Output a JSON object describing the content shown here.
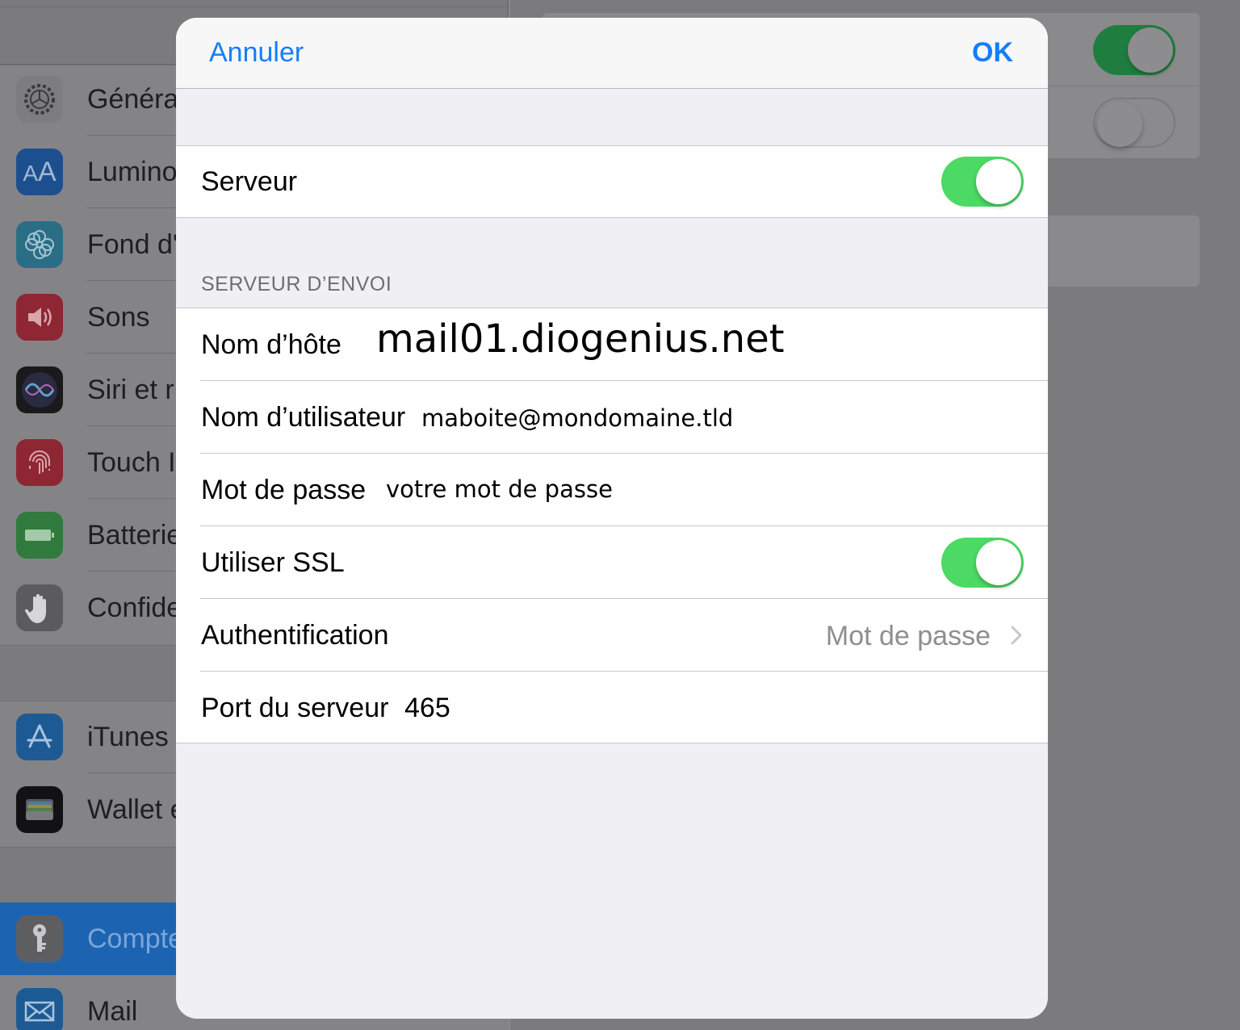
{
  "background": {
    "sidebar_items": [
      {
        "label": "Généra",
        "icon": "gear-icon",
        "color": "#8e8e93"
      },
      {
        "label": "Lumino",
        "icon": "text-size-icon",
        "color": "#1f6fd9"
      },
      {
        "label": "Fond d'",
        "icon": "wallpaper-flower-icon",
        "color": "#35a3cf"
      },
      {
        "label": "Sons",
        "icon": "speaker-icon",
        "color": "#e0394c"
      },
      {
        "label": "Siri et r",
        "icon": "siri-icon",
        "color": "#222222"
      },
      {
        "label": "Touch I",
        "icon": "fingerprint-icon",
        "color": "#e0394c"
      },
      {
        "label": "Batterie",
        "icon": "battery-icon",
        "color": "#4cd964"
      },
      {
        "label": "Confide",
        "icon": "hand-icon",
        "color": "#8e8e93"
      },
      {
        "label": "iTunes",
        "icon": "app-store-icon",
        "color": "#1f8cf0"
      },
      {
        "label": "Wallet e",
        "icon": "wallet-icon",
        "color": "#111111"
      },
      {
        "label": "Compte",
        "icon": "key-icon",
        "color": "#8e8e93"
      },
      {
        "label": "Mail",
        "icon": "mail-envelope-icon",
        "color": "#1f8cf0"
      }
    ]
  },
  "sheet": {
    "nav": {
      "cancel_label": "Annuler",
      "ok_label": "OK"
    },
    "server_row": {
      "label": "Serveur",
      "toggle_on": true
    },
    "section_header": "SERVEUR D’ENVOI",
    "rows": {
      "hostname": {
        "label": "Nom d’hôte",
        "value": "mail01.diogenius.net"
      },
      "username": {
        "label": "Nom d’utilisateur",
        "value": "maboite@mondomaine.tld"
      },
      "password": {
        "label": "Mot de passe",
        "value": "votre mot de passe"
      },
      "ssl": {
        "label": "Utiliser SSL",
        "toggle_on": true
      },
      "auth": {
        "label": "Authentification",
        "value": "Mot de passe"
      },
      "port": {
        "label": "Port du serveur",
        "value": "465"
      }
    }
  },
  "colors": {
    "accent": "#147efb",
    "switch_on": "#4cd964",
    "selected_sidebar": "#1c64b1"
  }
}
